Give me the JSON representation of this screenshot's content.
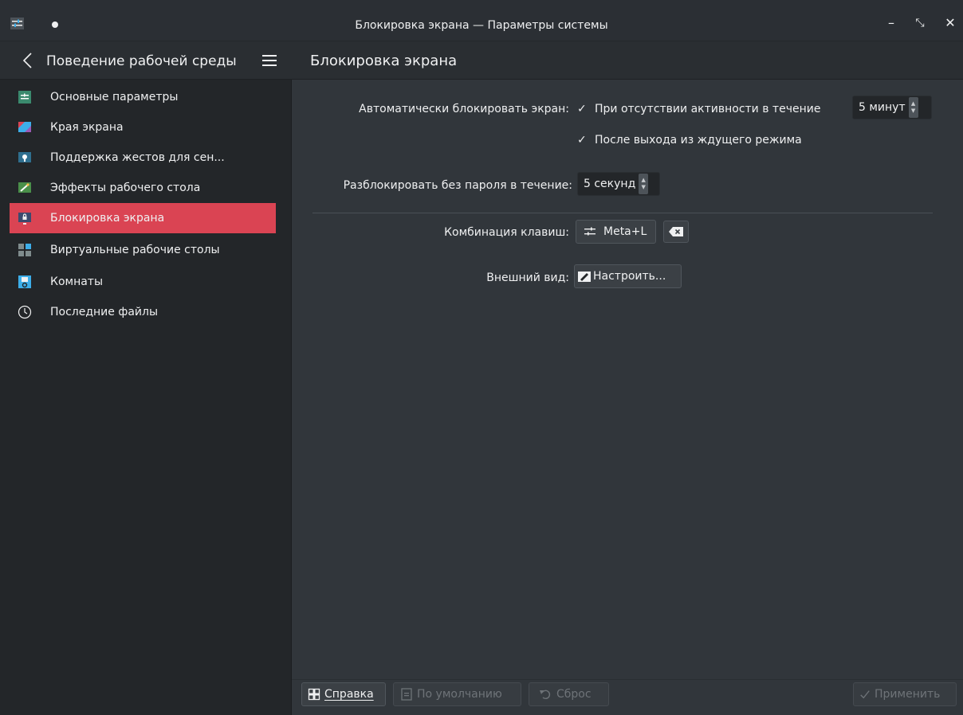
{
  "window": {
    "title": "Блокировка экрана — Параметры системы",
    "minimize_glyph": "–",
    "restore_glyph": "⤡",
    "close_glyph": "✕"
  },
  "sidebar": {
    "title": "Поведение рабочей среды",
    "items": [
      {
        "label": "Основные параметры",
        "icon": "general-settings-icon"
      },
      {
        "label": "Края экрана",
        "icon": "screen-edges-icon"
      },
      {
        "label": "Поддержка жестов для сен...",
        "icon": "touch-gestures-icon"
      },
      {
        "label": "Эффекты рабочего стола",
        "icon": "desktop-effects-icon"
      },
      {
        "label": "Блокировка экрана",
        "icon": "screen-lock-icon",
        "selected": true
      },
      {
        "label": "Виртуальные рабочие столы",
        "icon": "virtual-desktops-icon"
      },
      {
        "label": "Комнаты",
        "icon": "activities-icon"
      },
      {
        "label": "Последние файлы",
        "icon": "recent-files-icon"
      }
    ]
  },
  "content": {
    "title": "Блокировка экрана",
    "autolock": {
      "label": "Автоматически блокировать экран:",
      "check1": "При отсутствии активности в течение",
      "check1_mark": "✓",
      "timeout_value": "5 минут",
      "check2": "После выхода из ждущего режима",
      "check2_mark": "✓"
    },
    "grace": {
      "label": "Разблокировать без пароля в течение:",
      "value": "5 секунд"
    },
    "shortcut": {
      "label": "Комбинация клавиш:",
      "value": "Meta+L"
    },
    "appearance": {
      "label": "Внешний вид:",
      "button": "Настроить..."
    }
  },
  "footer": {
    "help": "Справка",
    "defaults": "По умолчанию",
    "reset": "Сброс",
    "apply": "Применить"
  },
  "colors": {
    "accent": "#da4453",
    "window_bg": "#31363b",
    "sidebar_bg": "#232629"
  }
}
